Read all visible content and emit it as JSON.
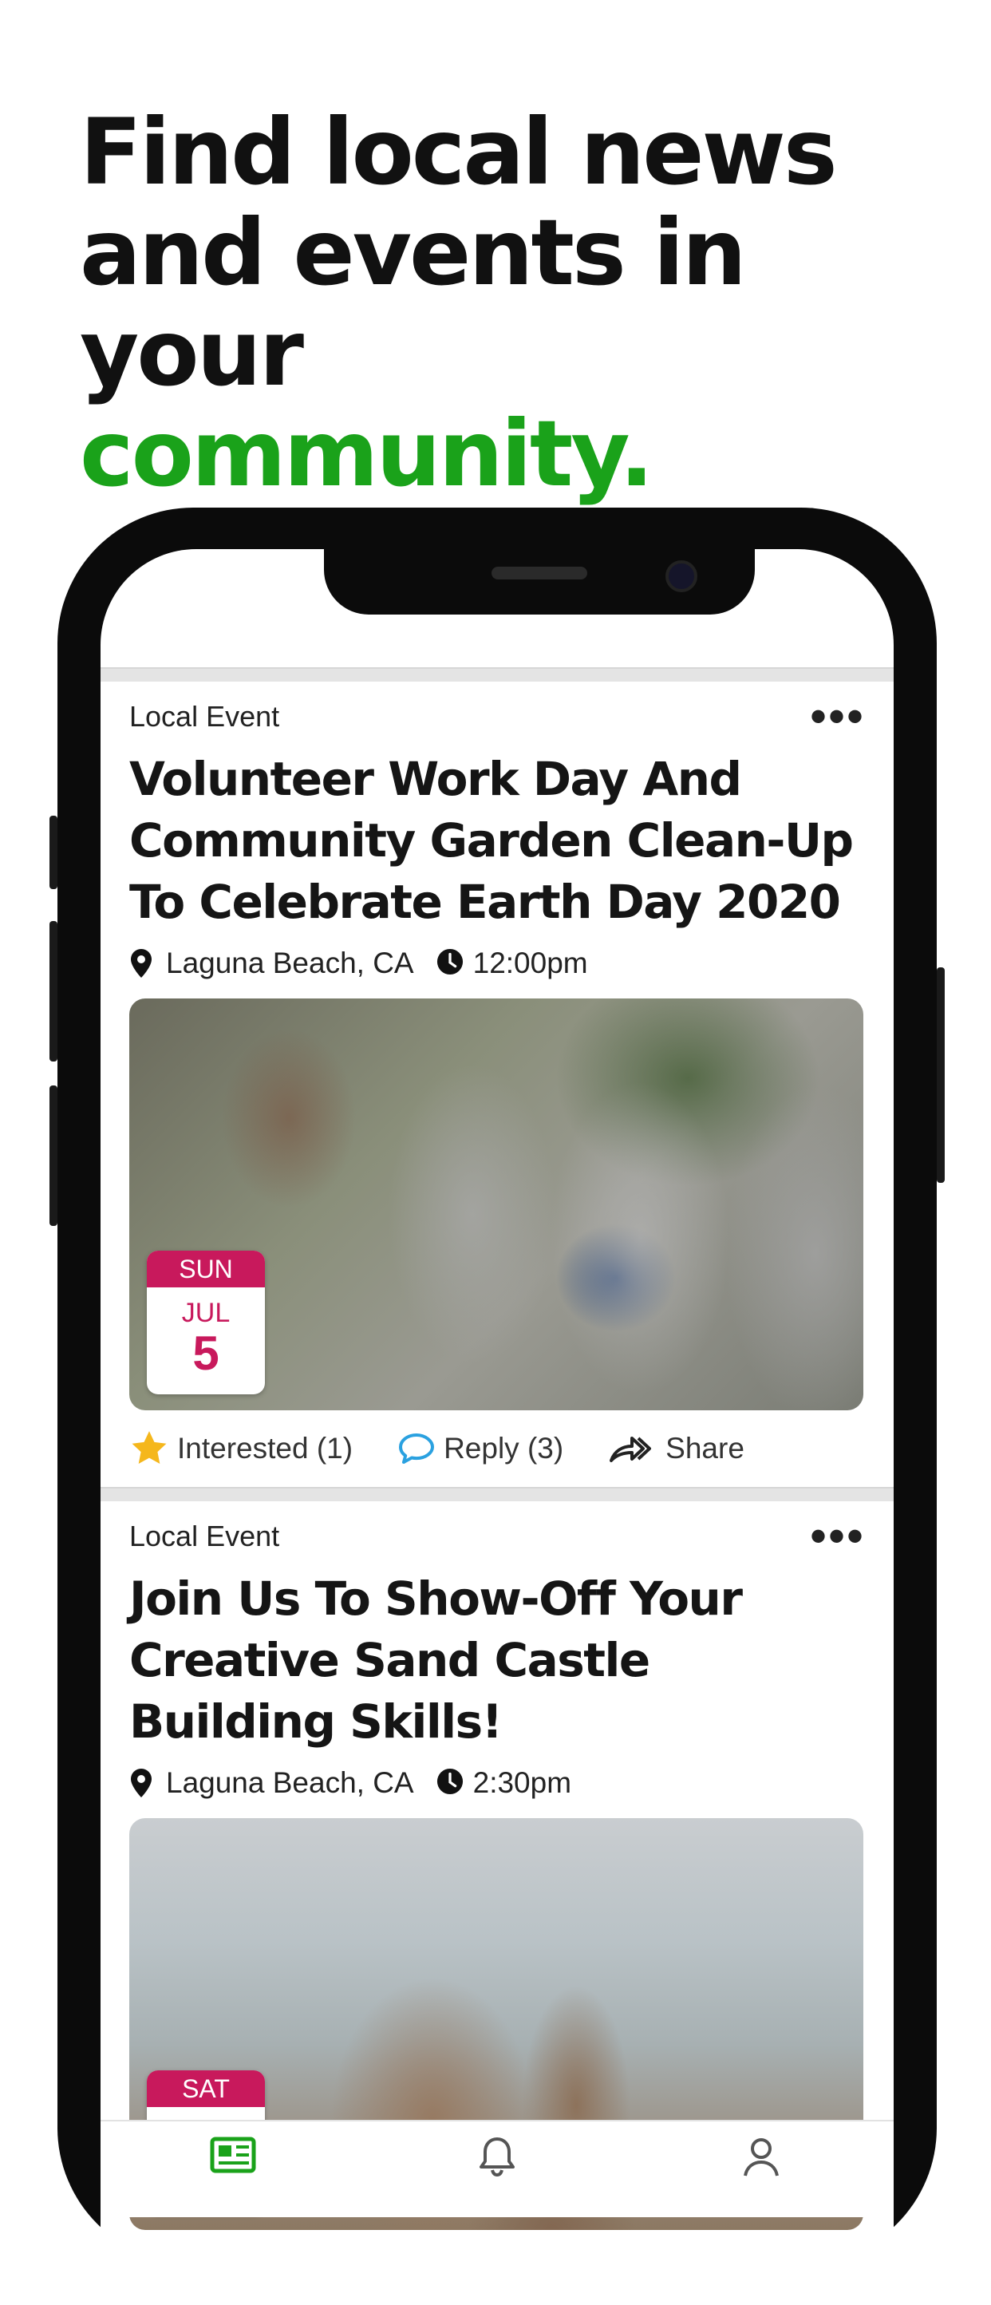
{
  "headline": {
    "line1": "Find local news",
    "line2": "and events in your",
    "accent": "community."
  },
  "colors": {
    "accent": "#1aa21a",
    "date_badge": "#c8195c",
    "star": "#f5b71c",
    "reply_icon": "#2aa1e0"
  },
  "feed": [
    {
      "category": "Local Event",
      "more": "•••",
      "title": "Volunteer Work Day And Community Garden Clean-Up To Celebrate Earth Day 2020",
      "location": "Laguna Beach, CA",
      "time": "12:00pm",
      "date": {
        "dow": "SUN",
        "month": "JUL",
        "day": "5"
      },
      "interested": "Interested (1)",
      "reply": "Reply (3)",
      "share": "Share"
    },
    {
      "category": "Local Event",
      "more": "•••",
      "title": "Join Us To Show-Off Your Creative Sand Castle Building Skills!",
      "location": "Laguna Beach, CA",
      "time": "2:30pm",
      "date": {
        "dow": "SAT"
      }
    }
  ],
  "tabbar": [
    "news-icon",
    "bell-icon",
    "profile-icon"
  ]
}
